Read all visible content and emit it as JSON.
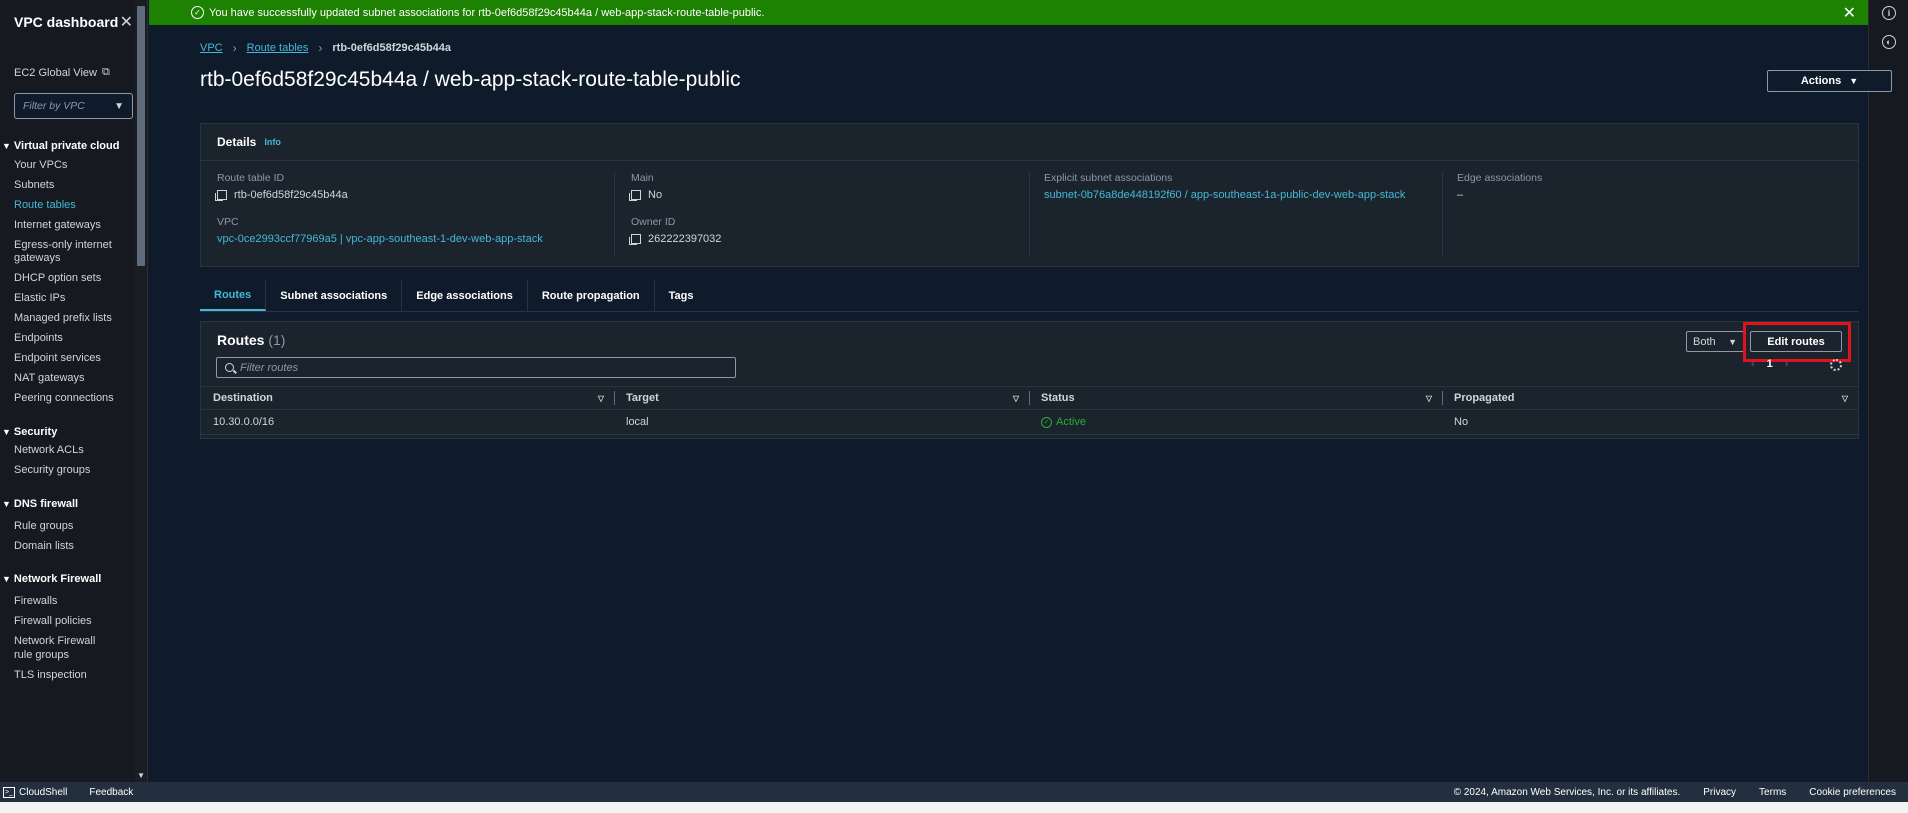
{
  "sidebar": {
    "title": "VPC dashboard",
    "ec2_link": "EC2 Global View",
    "filter_placeholder": "Filter by VPC",
    "sections": [
      {
        "label": "Virtual private cloud",
        "items": [
          "Your VPCs",
          "Subnets",
          "Route tables",
          "Internet gateways",
          "Egress-only internet gateways",
          "DHCP option sets",
          "Elastic IPs",
          "Managed prefix lists",
          "Endpoints",
          "Endpoint services",
          "NAT gateways",
          "Peering connections"
        ]
      },
      {
        "label": "Security",
        "items": [
          "Network ACLs",
          "Security groups"
        ]
      },
      {
        "label": "DNS firewall",
        "items": [
          "Rule groups",
          "Domain lists"
        ]
      },
      {
        "label": "Network Firewall",
        "items": [
          "Firewalls",
          "Firewall policies",
          "Network Firewall rule groups",
          "TLS inspection"
        ]
      }
    ],
    "active_item": "Route tables"
  },
  "flash": {
    "message": "You have successfully updated subnet associations for rtb-0ef6d58f29c45b44a / web-app-stack-route-table-public."
  },
  "breadcrumb": {
    "items": [
      "VPC",
      "Route tables"
    ],
    "current": "rtb-0ef6d58f29c45b44a"
  },
  "page_title": "rtb-0ef6d58f29c45b44a / web-app-stack-route-table-public",
  "actions_label": "Actions",
  "details": {
    "heading": "Details",
    "info": "Info",
    "route_table_id_label": "Route table ID",
    "route_table_id": "rtb-0ef6d58f29c45b44a",
    "vpc_label": "VPC",
    "vpc_value": "vpc-0ce2993ccf77969a5 | vpc-app-southeast-1-dev-web-app-stack",
    "main_label": "Main",
    "main_value": "No",
    "owner_label": "Owner ID",
    "owner_value": "262222397032",
    "explicit_label": "Explicit subnet associations",
    "explicit_value": "subnet-0b76a8de448192f60 / app-southeast-1a-public-dev-web-app-stack",
    "edge_label": "Edge associations",
    "edge_value": "–"
  },
  "tabs": [
    "Routes",
    "Subnet associations",
    "Edge associations",
    "Route propagation",
    "Tags"
  ],
  "routes": {
    "title": "Routes",
    "count": "(1)",
    "filter_placeholder": "Filter routes",
    "both_label": "Both",
    "edit_label": "Edit routes",
    "page_number": "1",
    "columns": [
      "Destination",
      "Target",
      "Status",
      "Propagated"
    ],
    "rows": [
      {
        "destination": "10.30.0.0/16",
        "target": "local",
        "status": "Active",
        "propagated": "No"
      }
    ]
  },
  "footer": {
    "cloudshell": "CloudShell",
    "feedback": "Feedback",
    "copyright": "© 2024, Amazon Web Services, Inc. or its affiliates.",
    "privacy": "Privacy",
    "terms": "Terms",
    "cookies": "Cookie preferences"
  },
  "colors": {
    "accent": "#44b9d6",
    "success": "#1d8102",
    "active_status": "#29ad32",
    "highlight": "#e0121c"
  }
}
